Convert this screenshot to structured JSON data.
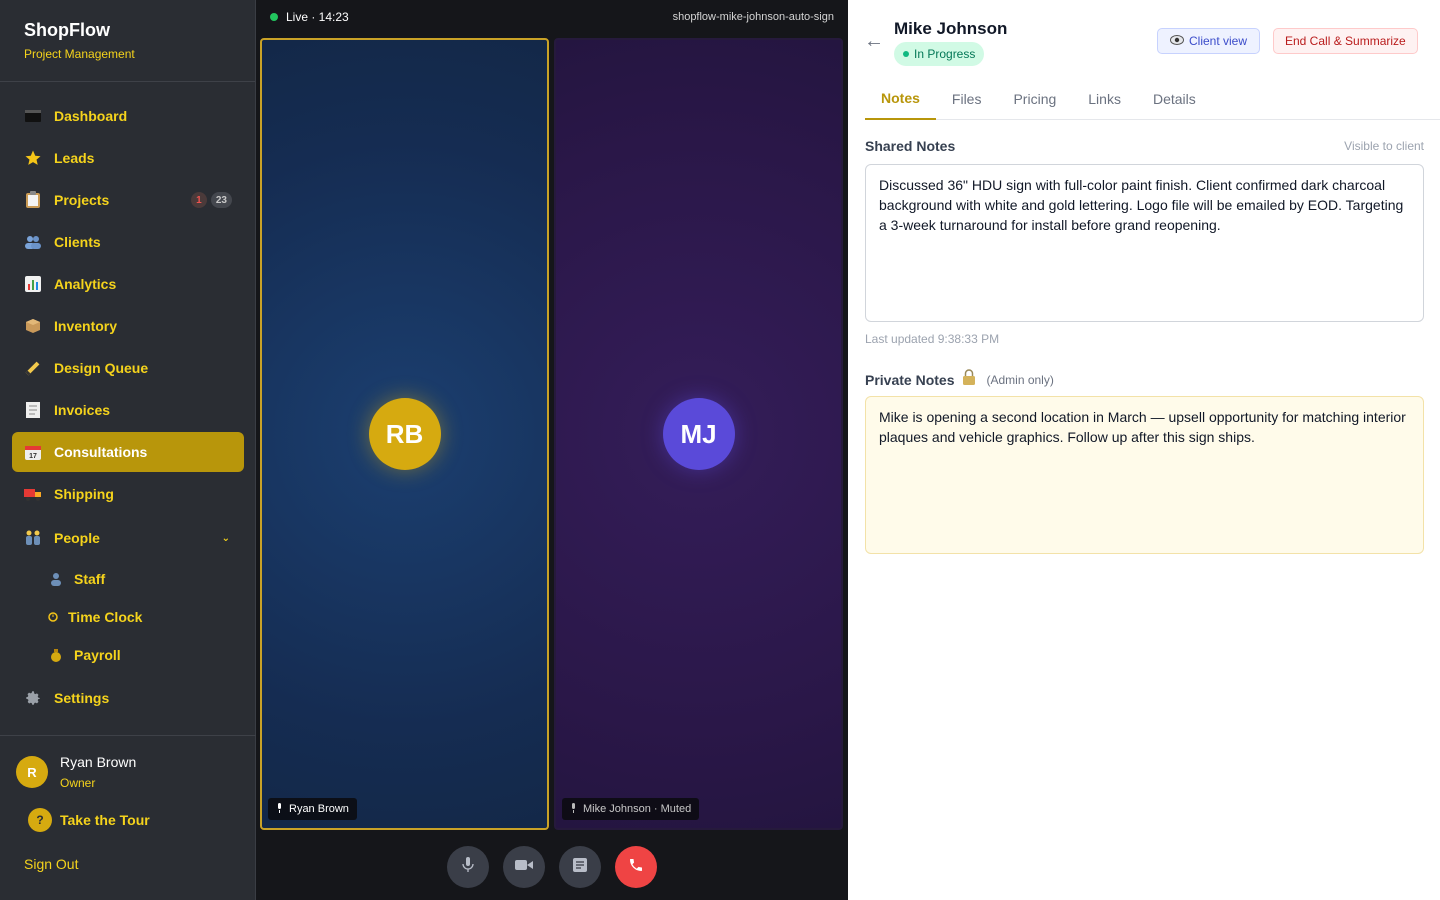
{
  "sidebar": {
    "brand": "ShopFlow",
    "brand_sub": "Project Management",
    "nav": [
      {
        "label": "Dashboard",
        "icon": "dashboard-icon"
      },
      {
        "label": "Leads",
        "icon": "star-icon"
      },
      {
        "label": "Projects",
        "icon": "clipboard-icon",
        "badge_alert": "1",
        "badge_count": "23"
      },
      {
        "label": "Clients",
        "icon": "users-icon"
      },
      {
        "label": "Analytics",
        "icon": "chart-icon"
      },
      {
        "label": "Inventory",
        "icon": "box-icon"
      },
      {
        "label": "Design Queue",
        "icon": "pencil-icon"
      },
      {
        "label": "Invoices",
        "icon": "receipt-icon"
      },
      {
        "label": "Consultations",
        "icon": "calendar-icon",
        "active": true
      },
      {
        "label": "Shipping",
        "icon": "truck-icon"
      },
      {
        "label": "People",
        "icon": "people-icon"
      }
    ],
    "people_sub": [
      {
        "label": "Staff",
        "icon": "person-icon"
      },
      {
        "label": "Time Clock",
        "icon": "clock-icon"
      },
      {
        "label": "Payroll",
        "icon": "money-bag-icon"
      }
    ],
    "settings": "Settings",
    "user": {
      "initial": "R",
      "name": "Ryan Brown",
      "role": "Owner"
    },
    "tour": {
      "icon_text": "?",
      "label": "Take the Tour"
    },
    "signout": "Sign Out"
  },
  "call": {
    "live": "Live · 14:23",
    "room": "shopflow-mike-johnson-auto-sign",
    "participants": [
      {
        "initials": "RB",
        "tag": "Ryan Brown",
        "color": "#d6aa10"
      },
      {
        "initials": "MJ",
        "tag": "Mike Johnson · Muted",
        "color": "#5a4ad9"
      }
    ]
  },
  "panel": {
    "client_name": "Mike Johnson",
    "status": "In Progress",
    "client_view": "Client view",
    "end_call": "End Call & Summarize",
    "tabs": [
      "Notes",
      "Files",
      "Pricing",
      "Links",
      "Details"
    ],
    "active_tab": "Notes",
    "shared_title": "Shared Notes",
    "shared_hint": "Visible to client",
    "shared_text": "Discussed 36\" HDU sign with full-color paint finish. Client confirmed dark charcoal background with white and gold lettering. Logo file will be emailed by EOD. Targeting a 3-week turnaround for install before grand reopening.",
    "last_updated": "Last updated 9:38:33 PM",
    "private_title": "Private Notes",
    "private_hint": "(Admin only)",
    "private_text": "Mike is opening a second location in March — upsell opportunity for matching interior plaques and vehicle graphics. Follow up after this sign ships."
  }
}
